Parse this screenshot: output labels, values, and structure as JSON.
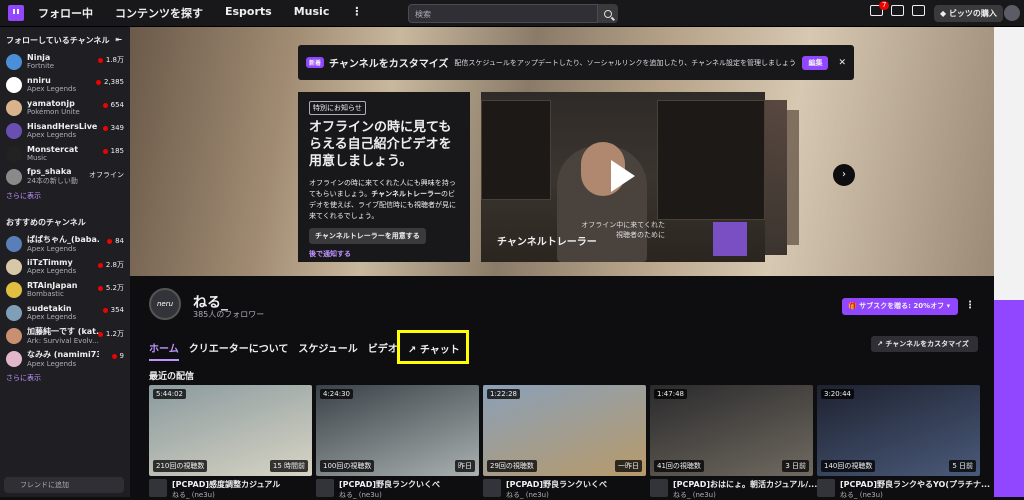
{
  "topbar": {
    "nav": [
      "フォロー中",
      "コンテンツを探す",
      "Esports",
      "Music"
    ],
    "more": "⋮",
    "search_placeholder": "検索",
    "notification_count": "7",
    "bits_label": "ビッツの購入"
  },
  "sidebar": {
    "followed_header": "フォローしているチャンネル",
    "collapse_icon": "collapse-arrow-icon",
    "followed": [
      {
        "name": "Ninja",
        "game": "Fortnite",
        "count": "1.8万",
        "color": "#4a90d9"
      },
      {
        "name": "nniru",
        "game": "Apex Legends",
        "count": "2,385",
        "color": "#ffffff"
      },
      {
        "name": "yamatonjp",
        "game": "Pokémon Unite",
        "count": "654",
        "color": "#d9b38c"
      },
      {
        "name": "HisandHersLive",
        "game": "Apex Legends",
        "count": "349",
        "color": "#6a4fb3"
      },
      {
        "name": "Monstercat",
        "game": "Music",
        "count": "185",
        "color": "#222222"
      },
      {
        "name": "fps_shaka",
        "game": "24本の新しい動",
        "count": "オフライン",
        "color": "#8a8a8a"
      }
    ],
    "show_more_1": "さらに表示",
    "recommended_header": "おすすめのチャンネル",
    "recommended": [
      {
        "name": "ぱぱちゃん_(baba...",
        "game": "Apex Legends",
        "count": "84",
        "color": "#5a7fb8"
      },
      {
        "name": "iiTzTimmy",
        "game": "Apex Legends",
        "count": "2.8万",
        "color": "#d8c8a8"
      },
      {
        "name": "RTAinJapan",
        "game": "Bombastic",
        "count": "5.2万",
        "color": "#e0c040"
      },
      {
        "name": "sudetakin",
        "game": "Apex Legends",
        "count": "354",
        "color": "#7f9fb8"
      },
      {
        "name": "加藤純一です (kat...",
        "game": "Ark: Survival Evolv...",
        "count": "1.2万",
        "color": "#c89070"
      },
      {
        "name": "なみみ (namimi73)",
        "game": "Apex Legends",
        "count": "9",
        "color": "#e0b8c8"
      }
    ],
    "show_more_2": "さらに表示",
    "friend_search": "フレンドに追加"
  },
  "notice": {
    "badge": "新着",
    "title": "チャンネルをカスタマイズ",
    "text": "配信スケジュールをアップデートしたり、ソーシャルリンクを追加したり、チャンネル設定を管理しましょう",
    "edit": "編集",
    "close": "✕"
  },
  "promo": {
    "tag": "特別にお知らせ",
    "title": "オフラインの時に見てもらえる自己紹介ビデオを用意しましょう。",
    "desc_1": "オフラインの時に来てくれた人にも興味を持ってもらいましょう。",
    "desc_bold": "チャンネルトレーラー",
    "desc_2": "のビデオを使えば、ライブ配信時にも視聴者が見に来てくれるでしょう。",
    "button": "チャンネルトレーラーを用意する",
    "link": "後で通知する"
  },
  "video": {
    "caption": "チャンネルトレーラー",
    "subtitle": "オフライン中に来てくれた視聴者のために"
  },
  "channel": {
    "avatar_text": "neru",
    "name": "ねる_",
    "followers": "385人のフォロワー",
    "subscribe": "サブスクを贈る: 20%オフ",
    "customize": "チャンネルをカスタマイズ",
    "tabs": [
      "ホーム",
      "クリエーターについて",
      "スケジュール",
      "ビデオ"
    ],
    "chat_tab": "チャット",
    "recent_title": "最近の配信"
  },
  "videos": [
    {
      "duration": "5:44:02",
      "views": "210回の視聴数",
      "ago": "15 時間前",
      "title": "[PCPAD]感度調整カジュアル",
      "channel": "ねる_ (ne3u)",
      "bg1": "#8a9a9e",
      "bg2": "#d8d4c4"
    },
    {
      "duration": "4:24:30",
      "views": "100回の視聴数",
      "ago": "昨日",
      "title": "[PCPAD]野良ランクいくべ",
      "channel": "ねる_ (ne3u)",
      "bg1": "#3a4248",
      "bg2": "#a8b0b0"
    },
    {
      "duration": "1:22:28",
      "views": "29回の視聴数",
      "ago": "一昨日",
      "title": "[PCPAD]野良ランクいくべ",
      "channel": "ねる_ (ne3u)",
      "bg1": "#8aa0b8",
      "bg2": "#b89a6a"
    },
    {
      "duration": "1:47:48",
      "views": "41回の視聴数",
      "ago": "3 日前",
      "title": "[PCPAD]おはにょ。朝活カジュアル/...",
      "channel": "ねる_ (ne3u)",
      "bg1": "#2a2a2c",
      "bg2": "#706a60"
    },
    {
      "duration": "3:20:44",
      "views": "140回の視聴数",
      "ago": "5 日前",
      "title": "[PCPAD]野良ランクやるYO(プラチナ...",
      "channel": "ねる_ (ne3u)",
      "bg1": "#1e2230",
      "bg2": "#4a5a7a"
    }
  ]
}
